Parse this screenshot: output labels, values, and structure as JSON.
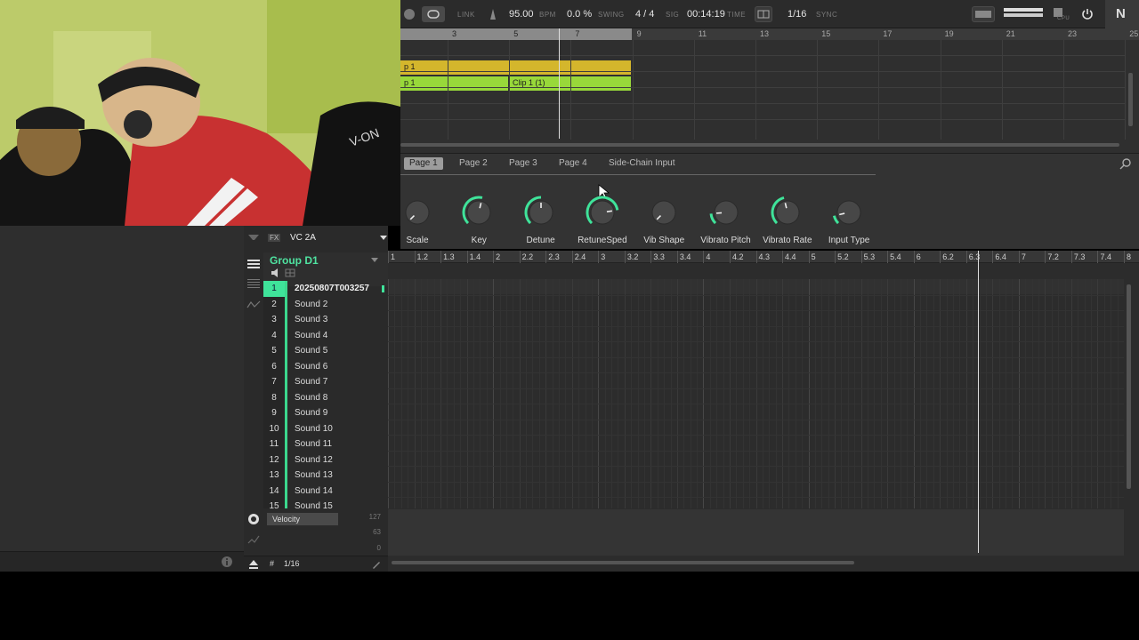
{
  "transport": {
    "link": "LINK",
    "bpm_value": "95.00",
    "bpm_label": "BPM",
    "swing_value": "0.0 %",
    "swing_label": "SWING",
    "sig_value": "4 / 4",
    "sig_label": "SIG",
    "time_value": "00:14:19",
    "time_label": "TIME",
    "quantize_value": "1/16",
    "sync_label": "SYNC",
    "cpu_label": "CPU",
    "logo": "N"
  },
  "arranger": {
    "ruler": [
      "3",
      "5",
      "7",
      "9",
      "11",
      "13",
      "15",
      "17",
      "19",
      "21",
      "23",
      "25"
    ],
    "clip_a": "p 1",
    "clip_b": "p 1",
    "clip_c": "Clip 1 (1)"
  },
  "pages": {
    "tabs": [
      "Page 1",
      "Page 2",
      "Page 3",
      "Page 4",
      "Side-Chain Input"
    ]
  },
  "knobs": [
    {
      "label": "Scale",
      "value": 0.0
    },
    {
      "label": "Key",
      "value": 0.55
    },
    {
      "label": "Detune",
      "value": 0.5
    },
    {
      "label": "RetuneSped",
      "value": 0.8
    },
    {
      "label": "Vib Shape",
      "value": 0.0
    },
    {
      "label": "Vibrato Pitch",
      "value": 0.15
    },
    {
      "label": "Vibrato Rate",
      "value": 0.45
    },
    {
      "label": "Input Type",
      "value": 0.12
    }
  ],
  "group": {
    "fx_label": "FX",
    "plugin_name": "VC 2A",
    "name": "Group D1"
  },
  "sounds": [
    {
      "num": "1",
      "name": "20250807T003257"
    },
    {
      "num": "2",
      "name": "Sound 2"
    },
    {
      "num": "3",
      "name": "Sound 3"
    },
    {
      "num": "4",
      "name": "Sound 4"
    },
    {
      "num": "5",
      "name": "Sound 5"
    },
    {
      "num": "6",
      "name": "Sound 6"
    },
    {
      "num": "7",
      "name": "Sound 7"
    },
    {
      "num": "8",
      "name": "Sound 8"
    },
    {
      "num": "9",
      "name": "Sound 9"
    },
    {
      "num": "10",
      "name": "Sound 10"
    },
    {
      "num": "11",
      "name": "Sound 11"
    },
    {
      "num": "12",
      "name": "Sound 12"
    },
    {
      "num": "13",
      "name": "Sound 13"
    },
    {
      "num": "14",
      "name": "Sound 14"
    },
    {
      "num": "15",
      "name": "Sound 15"
    }
  ],
  "pattern_ruler": [
    "1",
    "1.2",
    "1.3",
    "1.4",
    "2",
    "2.2",
    "2.3",
    "2.4",
    "3",
    "3.2",
    "3.3",
    "3.4",
    "4",
    "4.2",
    "4.3",
    "4.4",
    "5",
    "5.2",
    "5.3",
    "5.4",
    "6",
    "6.2",
    "6.3",
    "6.4",
    "7",
    "7.2",
    "7.3",
    "7.4",
    "8"
  ],
  "velocity": {
    "label": "Velocity",
    "max": "127",
    "mid": "63",
    "min": "0"
  },
  "footer": {
    "grid_value": "1/16"
  },
  "colors": {
    "accent_green": "#3fe39a",
    "clip_yellow": "#d4b62c",
    "clip_green": "#98d83a"
  }
}
